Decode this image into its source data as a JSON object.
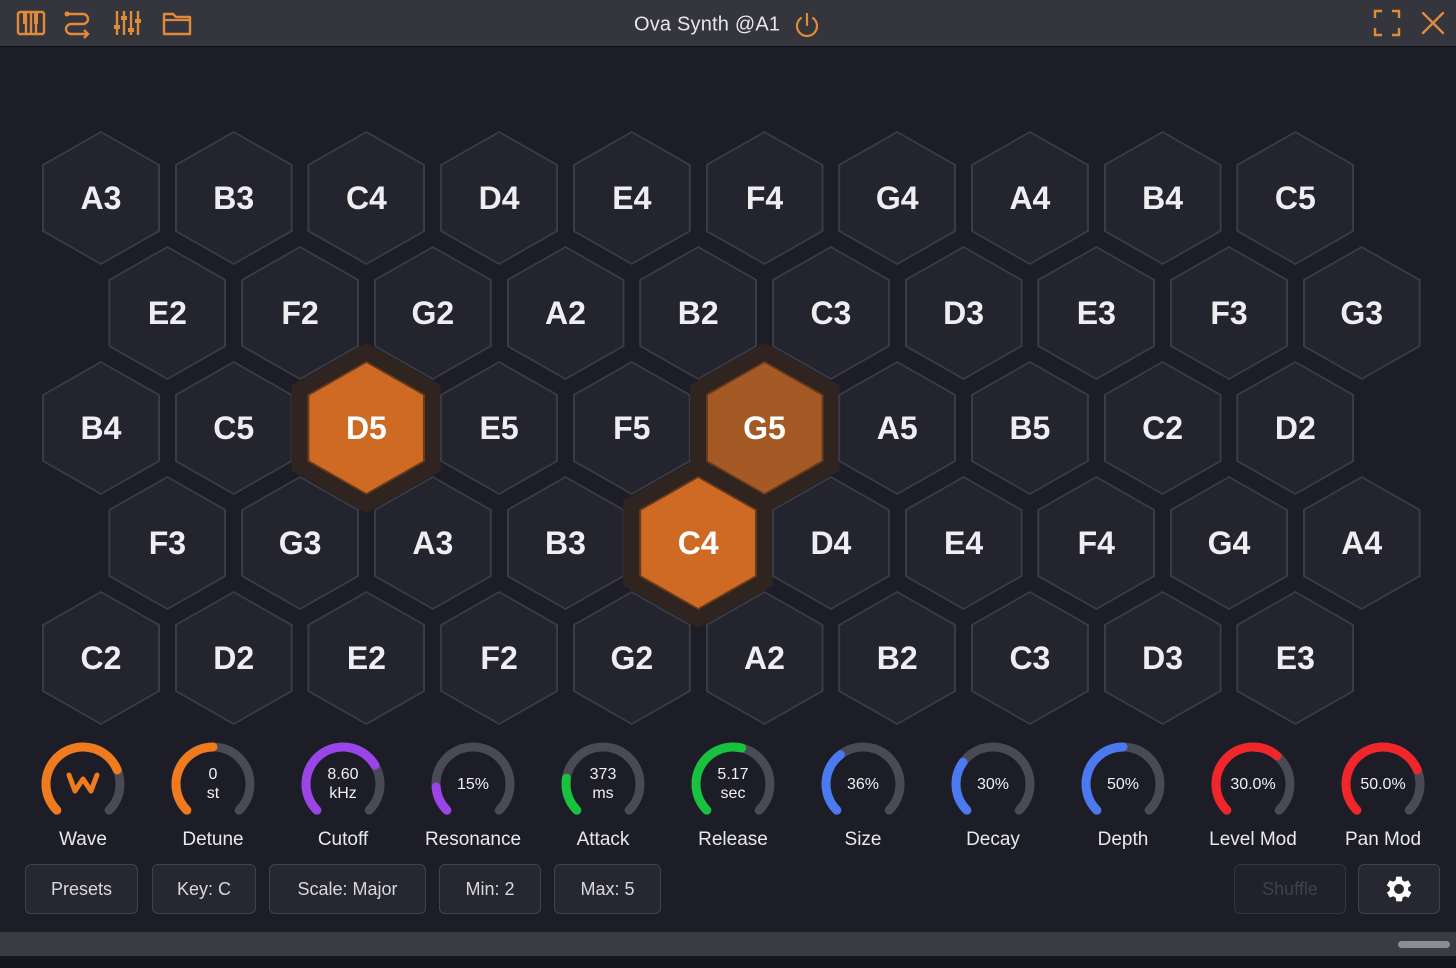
{
  "window": {
    "title": "Ova Synth @A1",
    "toolbar_icons": [
      "piano-keys-icon",
      "routing-icon",
      "mixer-icon",
      "folder-icon"
    ],
    "right_icons": [
      "fullscreen-icon",
      "close-icon"
    ]
  },
  "colors": {
    "accent": "#cf6a24",
    "hex_bg": "#23242d",
    "hex_border": "#3a3b44"
  },
  "hex_grid": {
    "rows": [
      {
        "offset": false,
        "notes": [
          "A3",
          "B3",
          "C4",
          "D4",
          "E4",
          "F4",
          "G4",
          "A4",
          "B4",
          "C5"
        ]
      },
      {
        "offset": true,
        "notes": [
          "E2",
          "F2",
          "G2",
          "A2",
          "B2",
          "C3",
          "D3",
          "E3",
          "F3",
          "G3"
        ]
      },
      {
        "offset": false,
        "notes": [
          "B4",
          "C5",
          "D5",
          "E5",
          "F5",
          "G5",
          "A5",
          "B5",
          "C2",
          "D2"
        ]
      },
      {
        "offset": true,
        "notes": [
          "F3",
          "G3",
          "A3",
          "B3",
          "C4",
          "D4",
          "E4",
          "F4",
          "G4",
          "A4"
        ]
      },
      {
        "offset": false,
        "notes": [
          "C2",
          "D2",
          "E2",
          "F2",
          "G2",
          "A2",
          "B2",
          "C3",
          "D3",
          "E3"
        ]
      }
    ],
    "active": [
      {
        "row": 2,
        "col": 2
      },
      {
        "row": 2,
        "col": 5
      },
      {
        "row": 3,
        "col": 4
      }
    ]
  },
  "knobs": [
    {
      "label": "Wave",
      "value_lines": [],
      "fraction": 0.75,
      "color": "#f07a1e",
      "icon": "wave-logo-icon"
    },
    {
      "label": "Detune",
      "value_lines": [
        "0",
        "st"
      ],
      "fraction": 0.5,
      "color": "#f07a1e"
    },
    {
      "label": "Cutoff",
      "value_lines": [
        "8.60",
        "kHz"
      ],
      "fraction": 0.72,
      "color": "#9b45e8"
    },
    {
      "label": "Resonance",
      "value_lines": [
        "15%"
      ],
      "fraction": 0.15,
      "color": "#9b45e8"
    },
    {
      "label": "Attack",
      "value_lines": [
        "373",
        "ms"
      ],
      "fraction": 0.2,
      "color": "#19c23e"
    },
    {
      "label": "Release",
      "value_lines": [
        "5.17",
        "sec"
      ],
      "fraction": 0.55,
      "color": "#19c23e"
    },
    {
      "label": "Size",
      "value_lines": [
        "36%"
      ],
      "fraction": 0.36,
      "color": "#4a79f0"
    },
    {
      "label": "Decay",
      "value_lines": [
        "30%"
      ],
      "fraction": 0.3,
      "color": "#4a79f0"
    },
    {
      "label": "Depth",
      "value_lines": [
        "50%"
      ],
      "fraction": 0.5,
      "color": "#4a79f0"
    },
    {
      "label": "Level Mod",
      "value_lines": [
        "30.0%"
      ],
      "fraction": 0.65,
      "color": "#f0262a"
    },
    {
      "label": "Pan Mod",
      "value_lines": [
        "50.0%"
      ],
      "fraction": 0.75,
      "color": "#f0262a"
    }
  ],
  "buttons": {
    "presets": "Presets",
    "key": "Key: C",
    "scale": "Scale: Major",
    "min": "Min: 2",
    "max": "Max: 5",
    "shuffle": "Shuffle"
  }
}
